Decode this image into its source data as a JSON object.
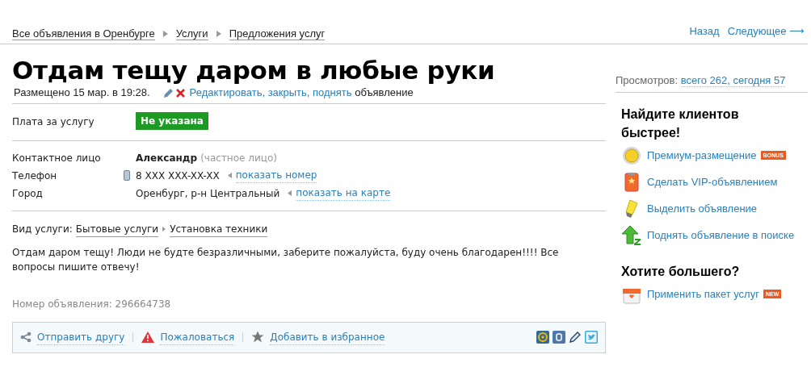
{
  "breadcrumbs": [
    "Все объявления в Оренбурге",
    "Услуги",
    "Предложения услуг"
  ],
  "nav": {
    "back": "Назад",
    "next": "Следующее ⟶"
  },
  "title": "Отдам тещу даром в любые руки",
  "meta": {
    "posted": "Размещено 15 мар. в 19:28.",
    "actions_link": "Редактировать, закрыть, поднять",
    "actions_suffix": "объявление"
  },
  "views": {
    "label": "Просмотров:",
    "value": "всего 262, сегодня 57"
  },
  "price": {
    "label": "Плата за услугу",
    "value": "Не указана"
  },
  "contact": [
    {
      "label": "Контактное лицо",
      "kind": "person",
      "value": "Александр",
      "note": "(частное лицо)"
    },
    {
      "label": "Телефон",
      "kind": "phone",
      "value": "8 XXX XXX-XX-XX",
      "link": "показать номер"
    },
    {
      "label": "Город",
      "kind": "city",
      "value": "Оренбург, р-н Центральный",
      "link": "показать на карте"
    }
  ],
  "category": {
    "label": "Вид услуги:",
    "path": [
      "Бытовые услуги",
      "Установка техники"
    ]
  },
  "description": "Отдам даром тещу! Люди не будте безразличными, заберите пожалуйста, буду очень благодарен!!!! Все вопросы пишите отвечу!",
  "ad_number": "Номер объявления: 296664738",
  "footer_actions": [
    {
      "kind": "share",
      "label": "Отправить другу"
    },
    {
      "kind": "report",
      "label": "Пожаловаться"
    },
    {
      "kind": "favorite",
      "label": "Добавить в избранное"
    }
  ],
  "sidebar": [
    {
      "heading": "Найдите клиентов быстрее!",
      "items": [
        {
          "kind": "coin",
          "label": "Премиум-размещение",
          "badge": "BONUS"
        },
        {
          "kind": "vip",
          "label": "Сделать VIP-объявлением"
        },
        {
          "kind": "marker",
          "label": "Выделить объявление"
        },
        {
          "kind": "up",
          "label": "Поднять объявление в поиске"
        }
      ]
    },
    {
      "heading": "Хотите большего?",
      "items": [
        {
          "kind": "box",
          "label": "Применить пакет услуг",
          "badge": "NEW"
        }
      ]
    }
  ]
}
